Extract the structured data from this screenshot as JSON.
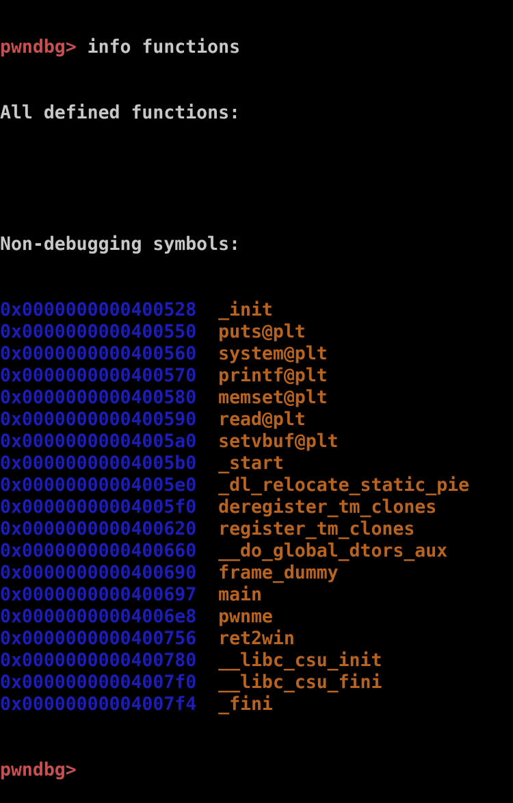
{
  "terminal": {
    "prompt": "pwndbg>",
    "command": "info functions",
    "header": "All defined functions:",
    "section_title": "Non-debugging symbols:",
    "functions": [
      {
        "address": "0x0000000000400528",
        "name": "_init"
      },
      {
        "address": "0x0000000000400550",
        "name": "puts@plt"
      },
      {
        "address": "0x0000000000400560",
        "name": "system@plt"
      },
      {
        "address": "0x0000000000400570",
        "name": "printf@plt"
      },
      {
        "address": "0x0000000000400580",
        "name": "memset@plt"
      },
      {
        "address": "0x0000000000400590",
        "name": "read@plt"
      },
      {
        "address": "0x00000000004005a0",
        "name": "setvbuf@plt"
      },
      {
        "address": "0x00000000004005b0",
        "name": "_start"
      },
      {
        "address": "0x00000000004005e0",
        "name": "_dl_relocate_static_pie"
      },
      {
        "address": "0x00000000004005f0",
        "name": "deregister_tm_clones"
      },
      {
        "address": "0x0000000000400620",
        "name": "register_tm_clones"
      },
      {
        "address": "0x0000000000400660",
        "name": "__do_global_dtors_aux"
      },
      {
        "address": "0x0000000000400690",
        "name": "frame_dummy"
      },
      {
        "address": "0x0000000000400697",
        "name": "main"
      },
      {
        "address": "0x00000000004006e8",
        "name": "pwnme"
      },
      {
        "address": "0x0000000000400756",
        "name": "ret2win"
      },
      {
        "address": "0x0000000000400780",
        "name": "__libc_csu_init"
      },
      {
        "address": "0x00000000004007f0",
        "name": "__libc_csu_fini"
      },
      {
        "address": "0x00000000004007f4",
        "name": "_fini"
      }
    ],
    "final_prompt": "pwndbg>",
    "colors": {
      "background": "#000000",
      "prompt": "#c85050",
      "text": "#c8c8c8",
      "address": "#1c1cb8",
      "symbol": "#b86420"
    }
  }
}
